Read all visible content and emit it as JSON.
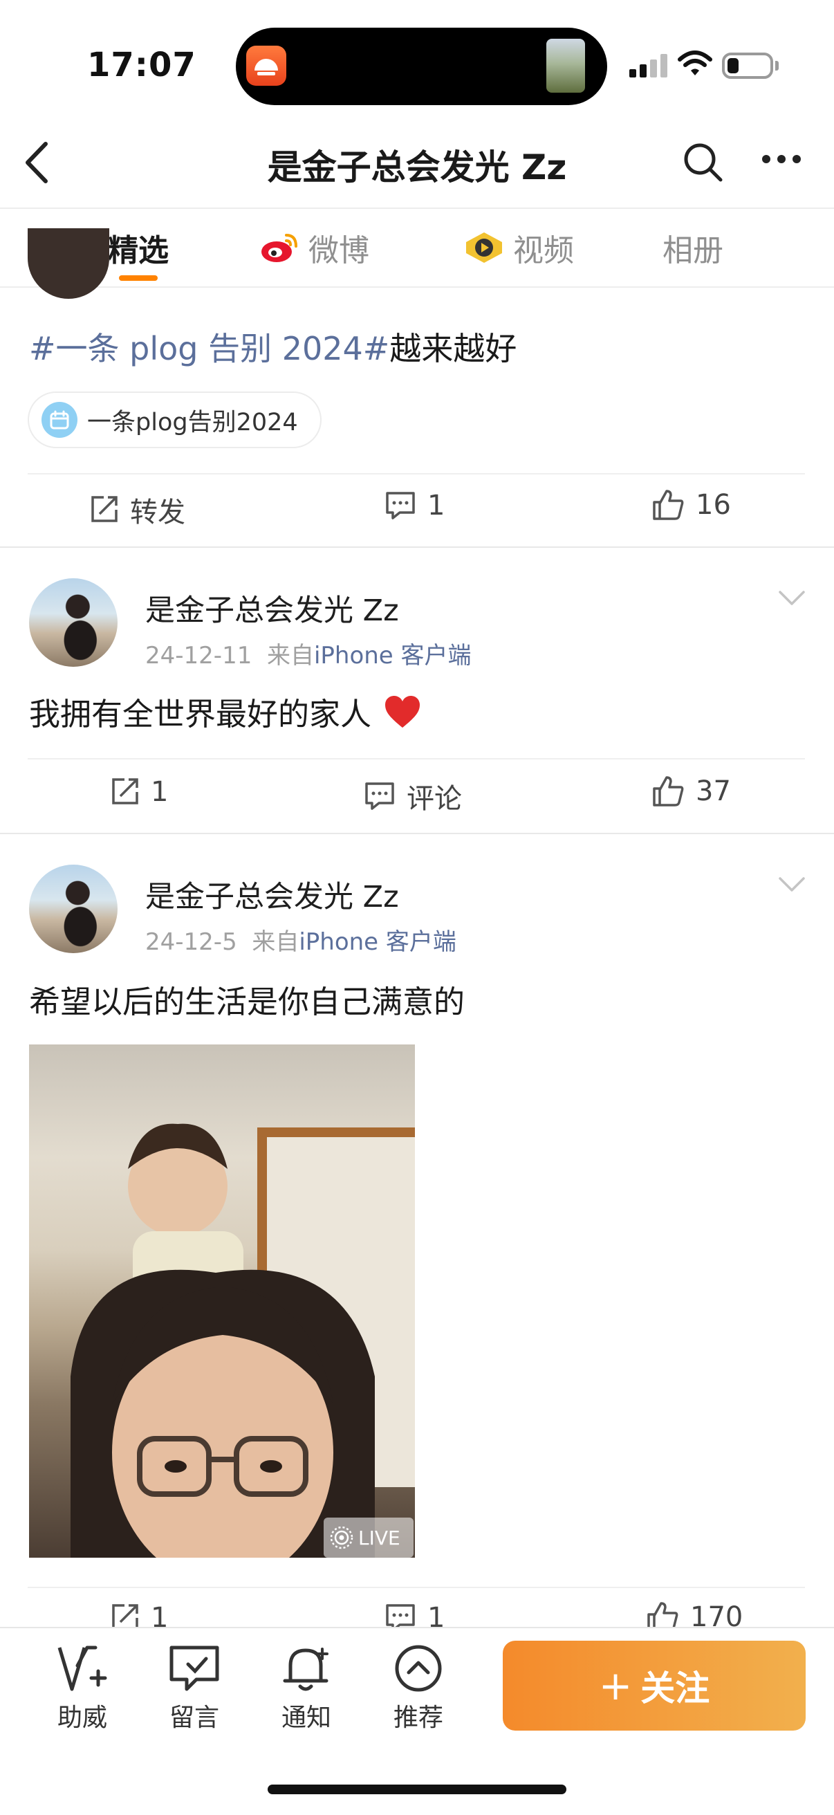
{
  "status_bar": {
    "time": "17:07"
  },
  "nav": {
    "title": "是金子总会发光 Zz"
  },
  "tabs": [
    {
      "label": "精选"
    },
    {
      "label": "微博"
    },
    {
      "label": "视频"
    },
    {
      "label": "相册"
    }
  ],
  "clipped_post": {
    "hashtag": "#一条 plog 告别 2024#",
    "text": "越来越好",
    "topic_chip": "一条plog告别2024",
    "actions": {
      "repost": "转发",
      "comments": "1",
      "likes": "16"
    }
  },
  "posts": [
    {
      "author": "是金子总会发光 Zz",
      "date": "24-12-11",
      "from_prefix": "来自",
      "source": "iPhone 客户端",
      "text": "我拥有全世界最好的家人",
      "emoji": "❤️",
      "actions": {
        "reposts": "1",
        "comment": "评论",
        "likes": "37"
      }
    },
    {
      "author": "是金子总会发光 Zz",
      "date": "24-12-5",
      "from_prefix": "来自",
      "source": "iPhone 客户端",
      "text": "希望以后的生活是你自己满意的",
      "live_label": "LIVE",
      "actions": {
        "reposts": "1",
        "comments": "1",
        "likes": "170"
      }
    }
  ],
  "toolbar": {
    "items": [
      {
        "label": "助威",
        "icon": "cheer-icon"
      },
      {
        "label": "留言",
        "icon": "message-icon"
      },
      {
        "label": "通知",
        "icon": "bell-icon"
      },
      {
        "label": "推荐",
        "icon": "recommend-icon"
      }
    ],
    "follow_label": "关注",
    "follow_plus": "+"
  },
  "colors": {
    "accent": "#ff8200",
    "link": "#5b6f9b",
    "follow_start": "#f48a2b",
    "follow_end": "#f2b04d"
  }
}
